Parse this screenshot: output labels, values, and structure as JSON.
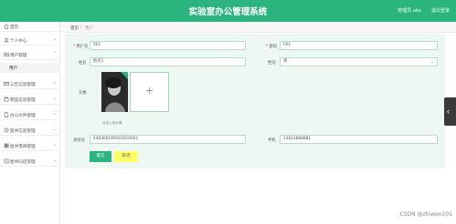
{
  "header": {
    "title": "实验室办公管理系统",
    "user": "管理员 abo",
    "logout": "退出登录"
  },
  "sidebar": {
    "items": [
      {
        "label": "首页",
        "icon": "home-icon"
      },
      {
        "label": "个人中心",
        "icon": "user-icon"
      },
      {
        "label": "用户管理",
        "icon": "users-icon"
      },
      {
        "label": "用户",
        "icon": ""
      },
      {
        "label": "公告信息管理",
        "icon": "notice-icon"
      },
      {
        "label": "物品信息管理",
        "icon": "box-icon"
      },
      {
        "label": "办公文件管理",
        "icon": "file-icon"
      },
      {
        "label": "图书信息管理",
        "icon": "book-icon"
      },
      {
        "label": "图书借阅管理",
        "icon": "grid-icon"
      },
      {
        "label": "图书归还管理",
        "icon": "return-icon"
      }
    ]
  },
  "breadcrumb": {
    "home": "首页",
    "sep": "/",
    "current": "用户"
  },
  "form": {
    "account_label": "用户名",
    "account_value": "001",
    "password_label": "密码",
    "password_value": "001",
    "name_label": "姓名",
    "name_value": "姓名1",
    "gender_label": "性别",
    "gender_value": "男",
    "avatar_label": "头像",
    "upload_hint": "点击上传头像",
    "id_label": "身份证",
    "id_value": "440300199101010001",
    "phone_label": "手机",
    "phone_value": "13823888881",
    "submit_label": "提交",
    "cancel_label": "取消"
  },
  "colors": {
    "accent": "#2cb47f",
    "panel_bg": "#edf8f2",
    "cancel_bg": "#ffff66"
  },
  "watermark": "CSDN @zhiwen201"
}
